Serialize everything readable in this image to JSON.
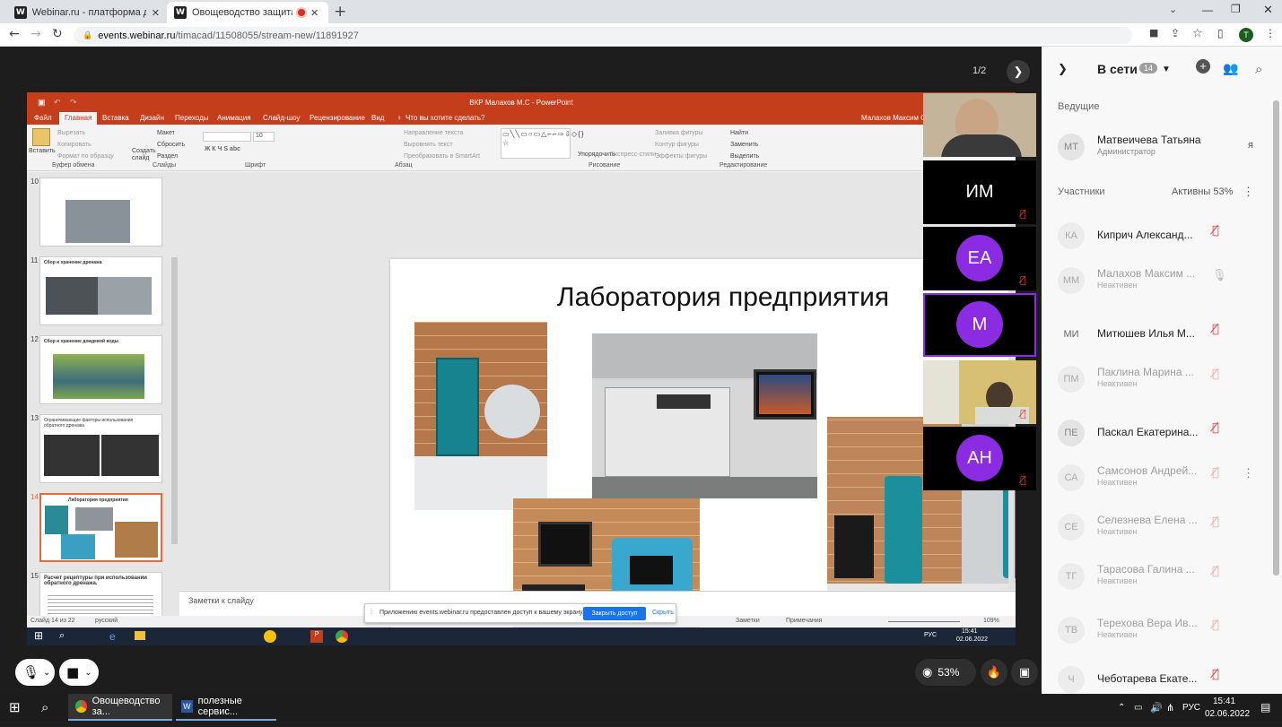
{
  "browser": {
    "tabs": [
      {
        "label": "Webinar.ru - платформа для пр",
        "active": false
      },
      {
        "label": "Овощеводство защита ито",
        "active": true
      }
    ],
    "url_host": "events.webinar.ru",
    "url_path": "/timacad/11508055/stream-new/11891927",
    "profile_initial": "T"
  },
  "stage": {
    "page_indicator": "1/2"
  },
  "ppt": {
    "window_title": "ВКР Малахов М.С - PowerPoint",
    "user": "Малахов Максим Се",
    "menu": [
      "Файл",
      "Главная",
      "Вставка",
      "Дизайн",
      "Переходы",
      "Анимация",
      "Слайд-шоу",
      "Рецензирование",
      "Вид"
    ],
    "search": "Что вы хотите сделать?",
    "ribbon": {
      "cut": "Вырезать",
      "copy": "Копировать",
      "format": "Формат по образцу",
      "paste": "Вставить",
      "create_slide": "Создать слайд",
      "layout": "Макет",
      "reset": "Сбросить",
      "section": "Раздел",
      "font_size": "10",
      "text_dir": "Направление текста",
      "align_text": "Выровнять текст",
      "smartart": "Преобразовать в SmartArt",
      "arrange": "Упорядочить",
      "quick_styles": "Экспресс-стили",
      "fill": "Заливка фигуры",
      "outline": "Контур фигуры",
      "effects": "Эффекты фигуры",
      "find": "Найти",
      "replace": "Заменить",
      "select": "Выделить",
      "groups": [
        "Буфер обмена",
        "Слайды",
        "Шрифт",
        "Абзац",
        "Рисование",
        "Редактирование"
      ]
    },
    "thumbnails": [
      {
        "num": "10",
        "title": ""
      },
      {
        "num": "11",
        "title": "Сбор и хранение дренажа"
      },
      {
        "num": "12",
        "title": "Сбор и хранение дождевой воды"
      },
      {
        "num": "13",
        "title": "Ограничивающие факторы использования обратного дренажа"
      },
      {
        "num": "14",
        "title": "Лаборатория предприятия"
      },
      {
        "num": "15",
        "title": "Расчет рецептуры при использовании обратного дренажа."
      }
    ],
    "slide_title": "Лаборатория предприятия",
    "notes_placeholder": "Заметки к слайду",
    "status_left": "Слайд 14 из 22",
    "status_lang": "русский",
    "status_notes": "Заметки",
    "status_comments": "Примечания",
    "zoom": "109%",
    "share_notice": "Приложению events.webinar.ru предоставлен доступ к вашему экрану.",
    "share_stop": "Закрыть доступ",
    "share_hide": "Скрыть",
    "inner_tray_lang": "РУС",
    "inner_tray_time": "15:41",
    "inner_tray_date": "02.06.2022"
  },
  "video_tiles": [
    {
      "type": "camera",
      "initials": ""
    },
    {
      "type": "text",
      "initials": "ИМ"
    },
    {
      "type": "circle",
      "initials": "ЕА"
    },
    {
      "type": "circle",
      "initials": "М"
    },
    {
      "type": "camera",
      "initials": ""
    },
    {
      "type": "circle",
      "initials": "АН"
    }
  ],
  "controls": {
    "viewers_pct": "53%"
  },
  "sidebar": {
    "online_label": "В сети",
    "online_count": "14",
    "hosts_label": "Ведущие",
    "host": {
      "initials": "МТ",
      "name": "Матвеичева Татьяна",
      "role": "Администратор",
      "lang": "я"
    },
    "participants_label": "Участники",
    "active_label": "Активны 53%",
    "participants": [
      {
        "initials": "КА",
        "name": "Киприч Александ...",
        "status": "",
        "dim": false
      },
      {
        "initials": "ММ",
        "name": "Малахов Максим ...",
        "status": "Неактивен",
        "dim": true
      },
      {
        "initials": "МИ",
        "name": "Митюшев Илья М...",
        "status": "",
        "dim": false
      },
      {
        "initials": "ПМ",
        "name": "Паклина Марина ...",
        "status": "Неактивен",
        "dim": true
      },
      {
        "initials": "ПЕ",
        "name": "Паскал Екатерина...",
        "status": "",
        "dim": false
      },
      {
        "initials": "СА",
        "name": "Самсонов Андрей...",
        "status": "Неактивен",
        "dim": true
      },
      {
        "initials": "СЕ",
        "name": "Селезнева Елена ...",
        "status": "Неактивен",
        "dim": true
      },
      {
        "initials": "ТГ",
        "name": "Тарасова Галина ...",
        "status": "Неактивен",
        "dim": true
      },
      {
        "initials": "ТВ",
        "name": "Терехова Вера Ив...",
        "status": "Неактивен",
        "dim": true
      },
      {
        "initials": "Ч",
        "name": "Чеботарева Екате...",
        "status": "",
        "dim": false
      }
    ]
  },
  "taskbar": {
    "apps": [
      {
        "label": "Овощеводство за..."
      },
      {
        "label": "полезные сервис..."
      }
    ],
    "lang": "РУС",
    "time": "15:41",
    "date": "02.06.2022"
  },
  "colors": {
    "accent_purple": "#8b2be2",
    "ppt_red": "#c43e1c",
    "mute_red": "#e53935",
    "share_blue": "#1a73e8"
  }
}
